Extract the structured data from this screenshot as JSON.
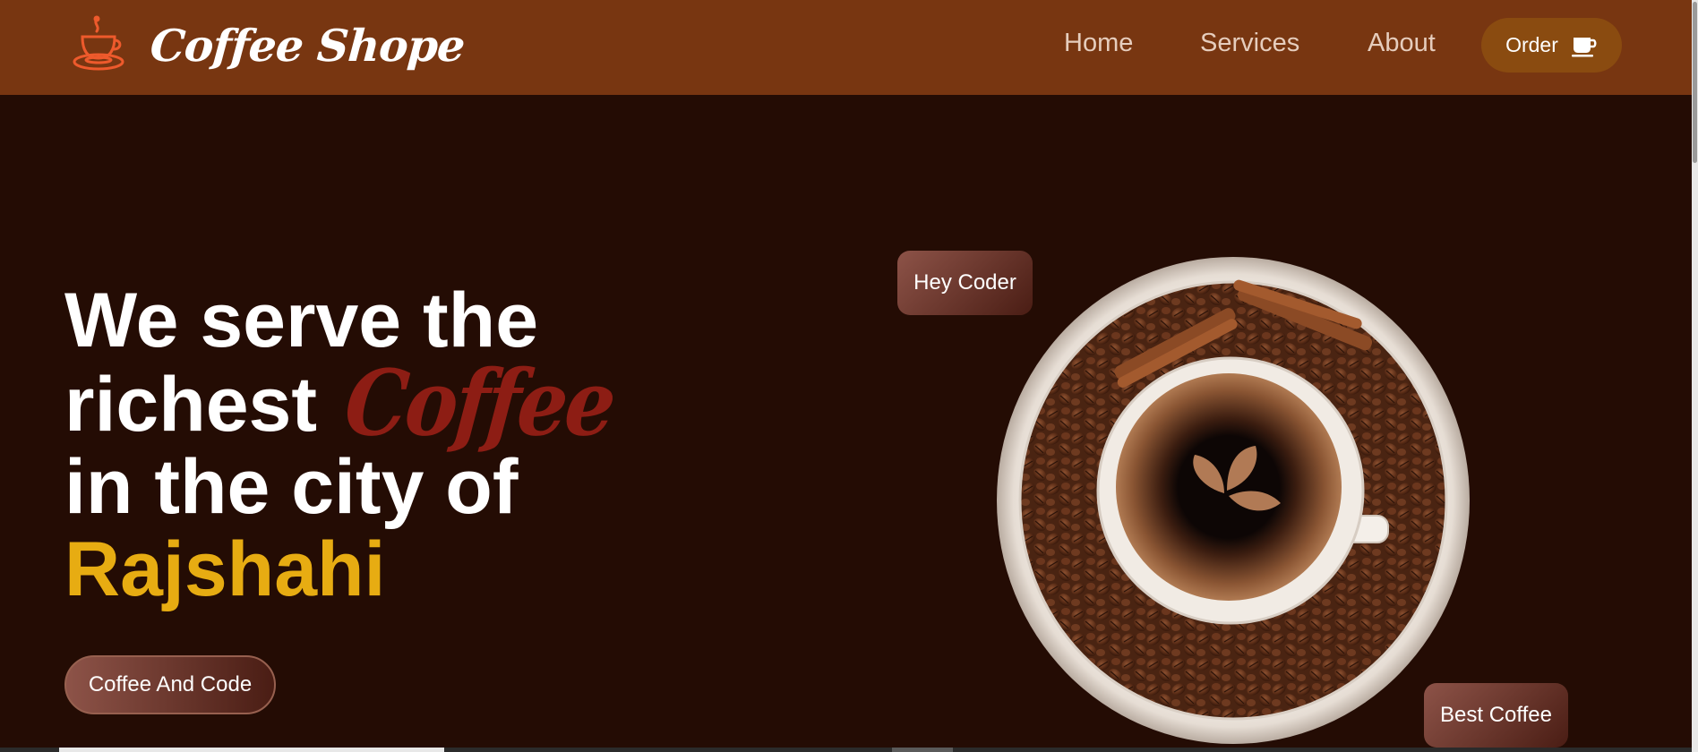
{
  "brand": {
    "name": "Coffee Shope",
    "logo_icon": "coffee-cup-logo-icon"
  },
  "nav": {
    "items": [
      {
        "label": "Home"
      },
      {
        "label": "Services"
      },
      {
        "label": "About"
      }
    ],
    "order_button": {
      "label": "Order",
      "icon": "coffee-mug-icon"
    }
  },
  "hero": {
    "line1": "We serve the",
    "line2_prefix": "richest",
    "line2_highlight": "Coffee",
    "line3": "in the city of",
    "city": "Rajshahi",
    "cta_label": "Coffee And Code"
  },
  "badges": {
    "top": "Hey Coder",
    "bottom": "Best Coffee"
  },
  "colors": {
    "navbar": "#783611",
    "background": "#240c04",
    "coffee_highlight": "#8d1d14",
    "city_highlight": "#e7ac12",
    "order_button": "#8a4b10"
  }
}
